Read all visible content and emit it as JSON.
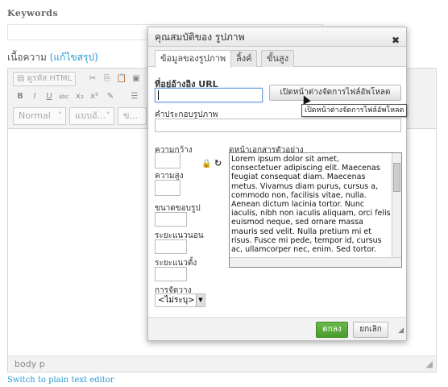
{
  "page": {
    "keywords_label": "Keywords",
    "content_label": "เนื้อความ",
    "content_link": "(แก้ไขสรุป)",
    "switch_link": "Switch to plain text editor",
    "statusbar_path": "body  p"
  },
  "editor_toolbar": {
    "source_button": "ดูรหัส HTML",
    "bold": "B",
    "italic": "I",
    "underline": "U",
    "strike": "abc",
    "subscript": "x₂",
    "superscript": "x²",
    "format_combo": "Normal",
    "font_combo": "แบบอั...",
    "size_combo": "ข..."
  },
  "dialog": {
    "title": "คุณสมบัติของ รูปภาพ",
    "close_label": "✖",
    "tabs": [
      {
        "label": "ข้อมูลของรูปภาพ"
      },
      {
        "label": "ลิ้งค์"
      },
      {
        "label": "ขั้นสูง"
      }
    ],
    "url_label": "ที่อยู่อ้างอิง URL",
    "url_value": "",
    "browse_button": "เปิดหน้าต่างจัดการไฟล์อัพโหลด",
    "tooltip": "เปิดหน้าต่างจัดการไฟล์อัพโหลด",
    "alt_label": "คำประกอบรูปภาพ",
    "width_label": "ความกว้าง",
    "height_label": "ความสูง",
    "border_label": "ขนาดขอบรูป",
    "hspace_label": "ระยะแนวนอน",
    "vspace_label": "ระยะแนวตั้ง",
    "align_label": "การจัดวาง",
    "align_value": "<ไม่ระบุ>",
    "preview_label": "ดูหน้าเอกสารตัวอย่าง",
    "preview_text": "Lorem ipsum dolor sit amet, consectetuer adipiscing elit. Maecenas feugiat consequat diam. Maecenas metus. Vivamus diam purus, cursus a, commodo non, facilisis vitae, nulla. Aenean dictum lacinia tortor. Nunc iaculis, nibh non iaculis aliquam, orci felis euismod neque, sed ornare massa mauris sed velit. Nulla pretium mi et risus. Fusce mi pede, tempor id, cursus ac, ullamcorper nec, enim. Sed tortor.",
    "ok_button": "ตกลง",
    "cancel_button": "ยกเลิก"
  },
  "colors": {
    "accent_link": "#2a9ad6",
    "ok_green": "#4a9a2d"
  }
}
